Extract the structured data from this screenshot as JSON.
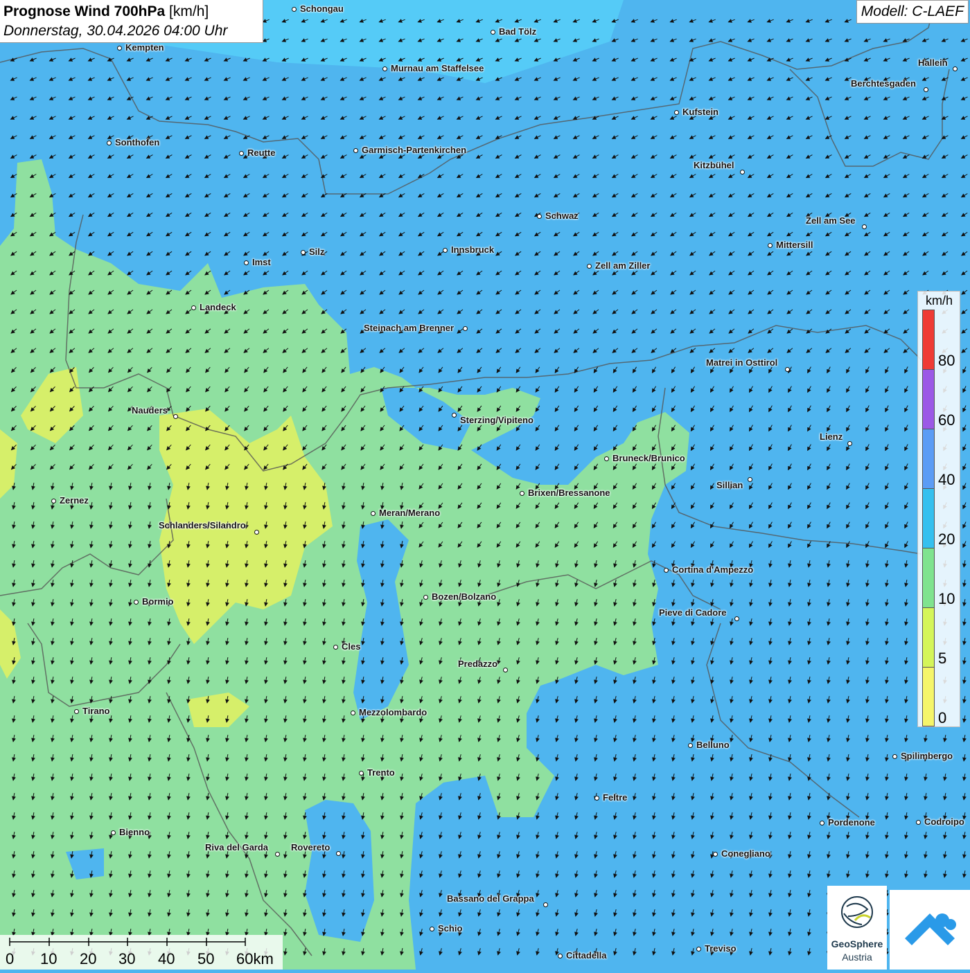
{
  "header": {
    "title_bold": "Prognose Wind 700hPa",
    "title_unit": "[km/h]",
    "datetime": "Donnerstag, 30.04.2026 04:00 Uhr"
  },
  "model": {
    "label": "Modell: C-LAEF"
  },
  "legend": {
    "unit": "km/h",
    "ticks": [
      "80",
      "60",
      "40",
      "20",
      "10",
      "5",
      "0"
    ],
    "colors": [
      "#ef3b35",
      "#9b59e6",
      "#5b9cf5",
      "#35c0ef",
      "#7fe38f",
      "#d4f55a",
      "#f5f56a"
    ]
  },
  "scalebar": {
    "labels": [
      "0",
      "10",
      "20",
      "30",
      "40",
      "50",
      "60km"
    ]
  },
  "branding": {
    "org_name": "GeoSphere",
    "org_sub": "Austria"
  },
  "colors": {
    "ocean_blue": "#4fb5ef",
    "green_zone": "#8fe0a0",
    "yellow_zone": "#d6ef6a",
    "lighter_blue": "#54d0f5"
  },
  "cities": [
    {
      "name": "Schongau",
      "dot": [
        424,
        13
      ],
      "lbl": [
        433,
        6
      ]
    },
    {
      "name": "Bad Tölz",
      "dot": [
        711,
        46
      ],
      "lbl": [
        720,
        39
      ]
    },
    {
      "name": "Kempten",
      "dot": [
        172,
        69
      ],
      "lbl": [
        181,
        62
      ]
    },
    {
      "name": "Murnau am Staffelsee",
      "dot": [
        555,
        99
      ],
      "lbl": [
        564,
        92
      ]
    },
    {
      "name": "Hallein",
      "dot": [
        1378,
        99
      ],
      "lbl": [
        1325,
        84
      ]
    },
    {
      "name": "Berchtesgaden",
      "dot": [
        1336,
        129
      ],
      "lbl": [
        1228,
        114
      ]
    },
    {
      "name": "Kufstein",
      "dot": [
        976,
        162
      ],
      "lbl": [
        985,
        155
      ]
    },
    {
      "name": "Sonthofen",
      "dot": [
        157,
        206
      ],
      "lbl": [
        166,
        199
      ]
    },
    {
      "name": "Reutte",
      "dot": [
        348,
        221
      ],
      "lbl": [
        357,
        214
      ]
    },
    {
      "name": "Garmisch-Partenkirchen",
      "dot": [
        513,
        217
      ],
      "lbl": [
        522,
        210
      ]
    },
    {
      "name": "Kitzbühel",
      "dot": [
        1071,
        248
      ],
      "lbl": [
        1001,
        232
      ]
    },
    {
      "name": "Schwaz",
      "dot": [
        778,
        312
      ],
      "lbl": [
        787,
        305
      ]
    },
    {
      "name": "Zell am See",
      "dot": [
        1247,
        327
      ],
      "lbl": [
        1163,
        312
      ]
    },
    {
      "name": "Mittersill",
      "dot": [
        1111,
        354
      ],
      "lbl": [
        1120,
        347
      ]
    },
    {
      "name": "Innsbruck",
      "dot": [
        642,
        361
      ],
      "lbl": [
        651,
        354
      ]
    },
    {
      "name": "Silz",
      "dot": [
        437,
        364
      ],
      "lbl": [
        446,
        357
      ]
    },
    {
      "name": "Imst",
      "dot": [
        355,
        379
      ],
      "lbl": [
        364,
        372
      ]
    },
    {
      "name": "Zell am Ziller",
      "dot": [
        850,
        384
      ],
      "lbl": [
        859,
        377
      ]
    },
    {
      "name": "Landeck",
      "dot": [
        279,
        444
      ],
      "lbl": [
        288,
        437
      ]
    },
    {
      "name": "Steinach am Brenner",
      "dot": [
        671,
        474
      ],
      "lbl": [
        525,
        467
      ]
    },
    {
      "name": "Matrei in Osttirol",
      "dot": [
        1136,
        533
      ],
      "lbl": [
        1019,
        517
      ]
    },
    {
      "name": "Nauders",
      "dot": [
        253,
        601
      ],
      "lbl": [
        190,
        586
      ]
    },
    {
      "name": "Sterzing/Vipiteno",
      "dot": [
        655,
        599
      ],
      "lbl": [
        664,
        600
      ]
    },
    {
      "name": "Lienz",
      "dot": [
        1226,
        640
      ],
      "lbl": [
        1183,
        624
      ]
    },
    {
      "name": "Bruneck/Brunico",
      "dot": [
        875,
        662
      ],
      "lbl": [
        884,
        655
      ]
    },
    {
      "name": "Sillian",
      "dot": [
        1082,
        692
      ],
      "lbl": [
        1034,
        694
      ]
    },
    {
      "name": "Brixen/Bressanone",
      "dot": [
        753,
        712
      ],
      "lbl": [
        762,
        705
      ]
    },
    {
      "name": "Zernez",
      "dot": [
        77,
        723
      ],
      "lbl": [
        86,
        716
      ]
    },
    {
      "name": "Meran/Merano",
      "dot": [
        538,
        741
      ],
      "lbl": [
        547,
        734
      ]
    },
    {
      "name": "Schlanders/Silandro",
      "dot": [
        370,
        768
      ],
      "lbl": [
        229,
        752
      ]
    },
    {
      "name": "Cortina d'Ampezzo",
      "dot": [
        961,
        823
      ],
      "lbl": [
        970,
        816
      ]
    },
    {
      "name": "Bozen/Bolzano",
      "dot": [
        614,
        862
      ],
      "lbl": [
        623,
        855
      ]
    },
    {
      "name": "Bormio",
      "dot": [
        196,
        869
      ],
      "lbl": [
        205,
        862
      ]
    },
    {
      "name": "Pieve di Cadore",
      "dot": [
        1063,
        893
      ],
      "lbl": [
        951,
        878
      ]
    },
    {
      "name": "Cles",
      "dot": [
        484,
        934
      ],
      "lbl": [
        493,
        927
      ]
    },
    {
      "name": "Predazzo",
      "dot": [
        729,
        967
      ],
      "lbl": [
        661,
        952
      ]
    },
    {
      "name": "Tirano",
      "dot": [
        110,
        1027
      ],
      "lbl": [
        119,
        1020
      ]
    },
    {
      "name": "Mezzolombardo",
      "dot": [
        509,
        1029
      ],
      "lbl": [
        518,
        1022
      ]
    },
    {
      "name": "Belluno",
      "dot": [
        996,
        1076
      ],
      "lbl": [
        1005,
        1069
      ]
    },
    {
      "name": "Spilimbergo",
      "dot": [
        1291,
        1092
      ],
      "lbl": [
        1300,
        1085
      ]
    },
    {
      "name": "Trento",
      "dot": [
        521,
        1116
      ],
      "lbl": [
        530,
        1109
      ]
    },
    {
      "name": "Feltre",
      "dot": [
        861,
        1152
      ],
      "lbl": [
        870,
        1145
      ]
    },
    {
      "name": "Pordenone",
      "dot": [
        1186,
        1188
      ],
      "lbl": [
        1195,
        1181
      ]
    },
    {
      "name": "Codroipo",
      "dot": [
        1325,
        1187
      ],
      "lbl": [
        1334,
        1180
      ]
    },
    {
      "name": "Bienno",
      "dot": [
        163,
        1202
      ],
      "lbl": [
        172,
        1195
      ]
    },
    {
      "name": "Riva del Garda",
      "dot": [
        400,
        1233
      ],
      "lbl": [
        296,
        1217
      ]
    },
    {
      "name": "Rovereto",
      "dot": [
        488,
        1232
      ],
      "lbl": [
        420,
        1217
      ]
    },
    {
      "name": "Conegliano",
      "dot": [
        1032,
        1233
      ],
      "lbl": [
        1041,
        1226
      ]
    },
    {
      "name": "Bassano del Grappa",
      "dot": [
        787,
        1306
      ],
      "lbl": [
        645,
        1291
      ]
    },
    {
      "name": "Schio",
      "dot": [
        623,
        1341
      ],
      "lbl": [
        632,
        1334
      ]
    },
    {
      "name": "Treviso",
      "dot": [
        1008,
        1370
      ],
      "lbl": [
        1017,
        1363
      ]
    },
    {
      "name": "Cittadella",
      "dot": [
        808,
        1380
      ],
      "lbl": [
        817,
        1373
      ]
    }
  ]
}
